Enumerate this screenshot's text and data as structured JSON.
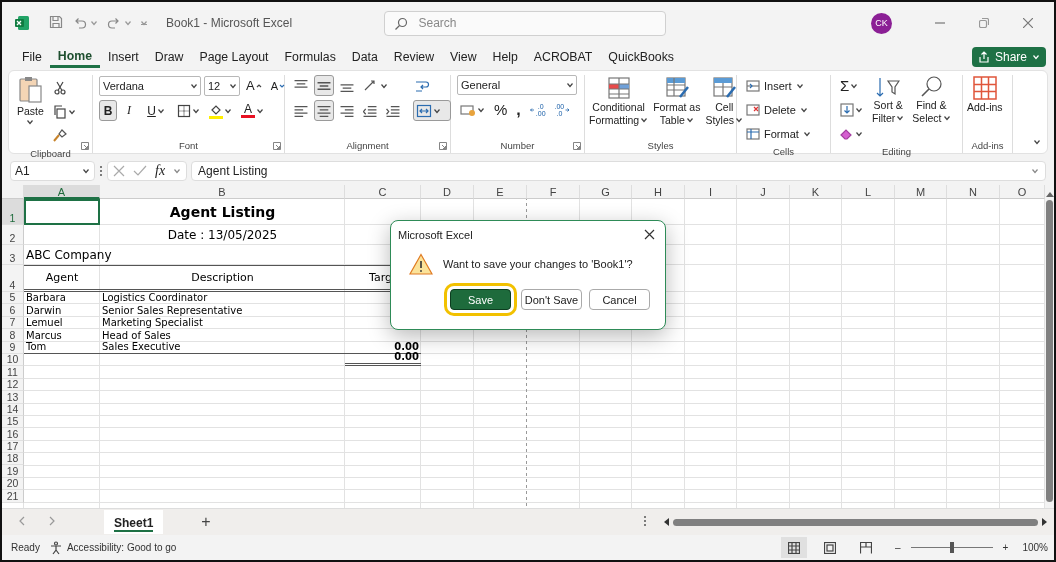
{
  "title_bar": {
    "title": "Book1  -  Microsoft Excel",
    "search": {
      "placeholder": "Search"
    },
    "avatar": "CK"
  },
  "menu": {
    "tabs": [
      {
        "label": "File",
        "selected": false
      },
      {
        "label": "Home",
        "selected": true
      },
      {
        "label": "Insert",
        "selected": false
      },
      {
        "label": "Draw",
        "selected": false
      },
      {
        "label": "Page Layout",
        "selected": false
      },
      {
        "label": "Formulas",
        "selected": false
      },
      {
        "label": "Data",
        "selected": false
      },
      {
        "label": "Review",
        "selected": false
      },
      {
        "label": "View",
        "selected": false
      },
      {
        "label": "Help",
        "selected": false
      },
      {
        "label": "ACROBAT",
        "selected": false
      },
      {
        "label": "QuickBooks",
        "selected": false
      }
    ],
    "share": "Share"
  },
  "ribbon": {
    "clipboard": {
      "label": "Clipboard",
      "paste": "Paste"
    },
    "font": {
      "label": "Font",
      "name": "Verdana",
      "size": "12",
      "grow": "A",
      "shrink": "A",
      "styles": [
        {
          "kind": "bold",
          "text": "B",
          "pressed": true
        },
        {
          "kind": "italic",
          "text": "I",
          "pressed": false
        },
        {
          "kind": "underline",
          "text": "U",
          "pressed": false
        }
      ],
      "font_color_letter": "A"
    },
    "alignment": {
      "label": "Alignment",
      "buttons": [
        {
          "kind": "top",
          "pressed": false
        },
        {
          "kind": "middle",
          "pressed": true
        },
        {
          "kind": "bottom",
          "pressed": false
        },
        {
          "kind": "left",
          "pressed": false
        },
        {
          "kind": "center",
          "pressed": true
        },
        {
          "kind": "right",
          "pressed": false
        },
        {
          "kind": "outdent",
          "pressed": false
        },
        {
          "kind": "indent",
          "pressed": false
        }
      ],
      "merge_pressed": true
    },
    "number": {
      "label": "Number",
      "format": "General",
      "percent": "%",
      "comma": ",",
      "increase_decimal": [
        ".0",
        ".00"
      ],
      "decrease_decimal": [
        ".00",
        ".0"
      ]
    },
    "styles": {
      "label": "Styles",
      "buttons": [
        {
          "kind": "conditional",
          "lines": [
            "Conditional",
            "Formatting"
          ]
        },
        {
          "kind": "table",
          "lines": [
            "Format as",
            "Table"
          ]
        },
        {
          "kind": "cell",
          "lines": [
            "Cell",
            "Styles"
          ]
        }
      ]
    },
    "cells": {
      "label": "Cells",
      "buttons": [
        {
          "kind": "insert",
          "label": "Insert"
        },
        {
          "kind": "delete",
          "label": "Delete"
        },
        {
          "kind": "format",
          "label": "Format"
        }
      ]
    },
    "editing": {
      "label": "Editing",
      "sum": "Σ",
      "buttons": [
        {
          "kind": "sort",
          "lines": [
            "Sort &",
            "Filter"
          ]
        },
        {
          "kind": "find",
          "lines": [
            "Find &",
            "Select"
          ]
        }
      ]
    },
    "addins": {
      "label": "Add-ins",
      "button": "Add-ins"
    }
  },
  "formula_bar": {
    "name_box": "A1",
    "fx": "fx",
    "content": "Agent Listing"
  },
  "sheet": {
    "columns": [
      {
        "label": "A",
        "selected": true
      },
      {
        "label": "B",
        "selected": false
      },
      {
        "label": "C",
        "selected": false
      },
      {
        "label": "D",
        "selected": false
      },
      {
        "label": "E",
        "selected": false
      },
      {
        "label": "F",
        "selected": false
      },
      {
        "label": "G",
        "selected": false
      },
      {
        "label": "H",
        "selected": false
      },
      {
        "label": "I",
        "selected": false
      },
      {
        "label": "J",
        "selected": false
      },
      {
        "label": "K",
        "selected": false
      },
      {
        "label": "L",
        "selected": false
      },
      {
        "label": "M",
        "selected": false
      },
      {
        "label": "N",
        "selected": false
      },
      {
        "label": "O",
        "selected": false
      }
    ],
    "rows": [
      {
        "number": "1",
        "selected": true,
        "kind": "title",
        "cells": {
          "B": "Agent Listing"
        }
      },
      {
        "number": "2",
        "selected": false,
        "kind": "subtitle",
        "cells": {
          "B": "Date : 13/05/2025"
        }
      },
      {
        "number": "3",
        "selected": false,
        "kind": "company",
        "cells": {
          "A": "ABC Company"
        }
      },
      {
        "number": "4",
        "selected": false,
        "kind": "header",
        "cells": {
          "A": "Agent",
          "B": "Description",
          "C": "Targ"
        }
      },
      {
        "number": "5",
        "selected": false,
        "kind": "data",
        "cells": {
          "A": "Barbara",
          "B": "Logistics Coordinator"
        }
      },
      {
        "number": "6",
        "selected": false,
        "kind": "data",
        "cells": {
          "A": "Darwin",
          "B": "Senior Sales Representative"
        }
      },
      {
        "number": "7",
        "selected": false,
        "kind": "data",
        "cells": {
          "A": "Lemuel",
          "B": "Marketing Specialist"
        }
      },
      {
        "number": "8",
        "selected": false,
        "kind": "data",
        "cells": {
          "A": "Marcus",
          "B": "Head of Sales"
        }
      },
      {
        "number": "9",
        "selected": false,
        "kind": "data_end",
        "cells": {
          "A": "Tom",
          "B": "Sales Executive",
          "C": "0.00"
        }
      },
      {
        "number": "10",
        "selected": false,
        "kind": "total",
        "cells": {
          "C": "0.00"
        }
      },
      {
        "number": "11",
        "selected": false,
        "kind": "empty"
      },
      {
        "number": "12",
        "selected": false,
        "kind": "empty"
      },
      {
        "number": "13",
        "selected": false,
        "kind": "empty"
      },
      {
        "number": "14",
        "selected": false,
        "kind": "empty"
      },
      {
        "number": "15",
        "selected": false,
        "kind": "empty"
      },
      {
        "number": "16",
        "selected": false,
        "kind": "empty"
      },
      {
        "number": "17",
        "selected": false,
        "kind": "empty"
      },
      {
        "number": "18",
        "selected": false,
        "kind": "empty"
      },
      {
        "number": "19",
        "selected": false,
        "kind": "empty"
      },
      {
        "number": "20",
        "selected": false,
        "kind": "empty"
      },
      {
        "number": "21",
        "selected": false,
        "kind": "empty"
      }
    ]
  },
  "dialog": {
    "title": "Microsoft Excel",
    "message": "Want to save your changes to 'Book1'?",
    "buttons": [
      {
        "label": "Save",
        "selected": true
      },
      {
        "label": "Don't Save",
        "selected": false
      },
      {
        "label": "Cancel",
        "selected": false
      }
    ]
  },
  "sheet_tabs": {
    "tabs": [
      {
        "label": "Sheet1",
        "selected": true
      }
    ],
    "add": "+"
  },
  "status_bar": {
    "status": "Ready",
    "accessibility": "Accessibility: Good to go",
    "zoom": {
      "minus": "–",
      "plus": "+",
      "level": 0.5,
      "reading": "100%"
    }
  }
}
